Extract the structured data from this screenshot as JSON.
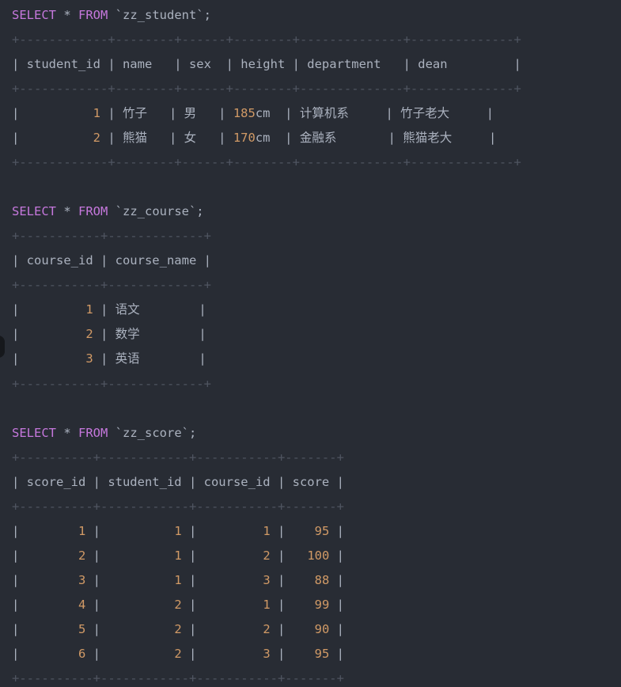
{
  "theme": {
    "background": "#282c34",
    "text": "#abb2bf",
    "keyword": "#c678dd",
    "number": "#d19a66",
    "border": "#5c6370"
  },
  "queries": {
    "student": {
      "kw1": "SELECT",
      "star": " * ",
      "kw2": "FROM",
      "rest": " `zz_student`;"
    },
    "course": {
      "kw1": "SELECT",
      "star": " * ",
      "kw2": "FROM",
      "rest": " `zz_course`;"
    },
    "score": {
      "kw1": "SELECT",
      "star": " * ",
      "kw2": "FROM",
      "rest": " `zz_score`;"
    }
  },
  "student": {
    "border": "+------------+--------+------+--------+--------------+--------------+",
    "header": "| student_id | name   | sex  | height | department   | dean         |",
    "rows": [
      {
        "pre": "|          ",
        "id": "1",
        "mid1": " | 竹子   | 男   | ",
        "h": "185",
        "mid2": "cm  | 计算机系     | 竹子老大     |"
      },
      {
        "pre": "|          ",
        "id": "2",
        "mid1": " | 熊猫   | 女   | ",
        "h": "170",
        "mid2": "cm  | 金融系       | 熊猫老大     |"
      }
    ]
  },
  "course": {
    "border": "+-----------+-------------+",
    "header": "| course_id | course_name |",
    "rows": [
      {
        "pre": "|         ",
        "id": "1",
        "post": " | 语文        |"
      },
      {
        "pre": "|         ",
        "id": "2",
        "post": " | 数学        |"
      },
      {
        "pre": "|         ",
        "id": "3",
        "post": " | 英语        |"
      }
    ]
  },
  "score": {
    "border": "+----------+------------+-----------+-------+",
    "header": "| score_id | student_id | course_id | score |",
    "rows": [
      {
        "p1": "|        ",
        "a": "1",
        "p2": " |          ",
        "b": "1",
        "p3": " |         ",
        "c": "1",
        "p4": " |    ",
        "d": "95",
        "p5": " |"
      },
      {
        "p1": "|        ",
        "a": "2",
        "p2": " |          ",
        "b": "1",
        "p3": " |         ",
        "c": "2",
        "p4": " |   ",
        "d": "100",
        "p5": " |"
      },
      {
        "p1": "|        ",
        "a": "3",
        "p2": " |          ",
        "b": "1",
        "p3": " |         ",
        "c": "3",
        "p4": " |    ",
        "d": "88",
        "p5": " |"
      },
      {
        "p1": "|        ",
        "a": "4",
        "p2": " |          ",
        "b": "2",
        "p3": " |         ",
        "c": "1",
        "p4": " |    ",
        "d": "99",
        "p5": " |"
      },
      {
        "p1": "|        ",
        "a": "5",
        "p2": " |          ",
        "b": "2",
        "p3": " |         ",
        "c": "2",
        "p4": " |    ",
        "d": "90",
        "p5": " |"
      },
      {
        "p1": "|        ",
        "a": "6",
        "p2": " |          ",
        "b": "2",
        "p3": " |         ",
        "c": "3",
        "p4": " |    ",
        "d": "95",
        "p5": " |"
      }
    ]
  }
}
